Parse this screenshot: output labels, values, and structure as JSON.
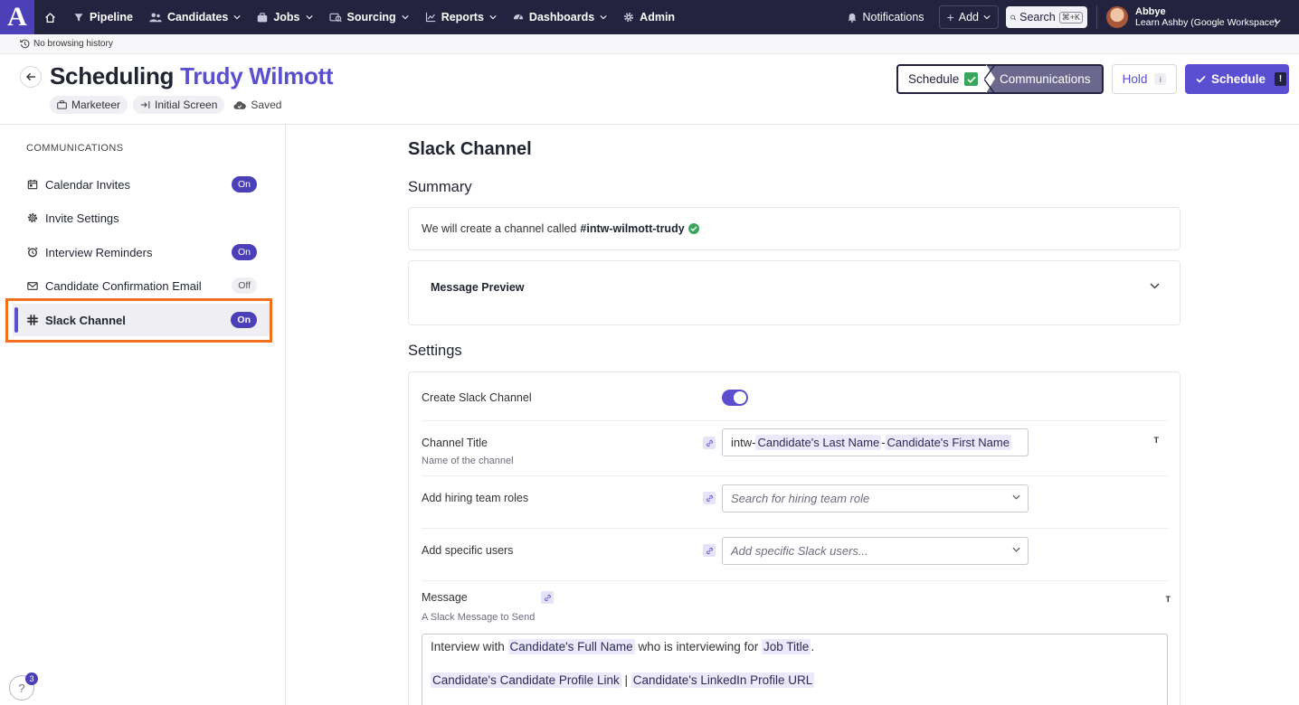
{
  "nav": {
    "logo": "A",
    "items": [
      {
        "label": "Pipeline",
        "icon": "filter-icon",
        "chevron": false
      },
      {
        "label": "Candidates",
        "icon": "people-icon",
        "chevron": true
      },
      {
        "label": "Jobs",
        "icon": "briefcase-icon",
        "chevron": true
      },
      {
        "label": "Sourcing",
        "icon": "sourcing-icon",
        "chevron": true
      },
      {
        "label": "Reports",
        "icon": "chart-icon",
        "chevron": true
      },
      {
        "label": "Dashboards",
        "icon": "dashboard-icon",
        "chevron": true
      },
      {
        "label": "Admin",
        "icon": "gear-icon",
        "chevron": false
      }
    ],
    "notifications": "Notifications",
    "add": "Add",
    "search": "Search",
    "search_shortcut": "⌘+K",
    "user_name": "Abbye",
    "user_org": "Learn Ashby (Google Workspace)"
  },
  "history": {
    "label": "No browsing history"
  },
  "header": {
    "title_prefix": "Scheduling",
    "candidate": "Trudy Wilmott",
    "tags": [
      "Marketeer",
      "Initial Screen"
    ],
    "saved": "Saved",
    "step1": "Schedule",
    "step2": "Communications",
    "hold": "Hold",
    "hold_badge": "i",
    "schedule": "Schedule",
    "schedule_badge": "!"
  },
  "sidebar": {
    "heading": "COMMUNICATIONS",
    "items": [
      {
        "label": "Calendar Invites",
        "status": "On",
        "icon": "calendar-icon"
      },
      {
        "label": "Invite Settings",
        "status": "",
        "icon": "gear-icon"
      },
      {
        "label": "Interview Reminders",
        "status": "On",
        "icon": "alarm-icon"
      },
      {
        "label": "Candidate Confirmation Email",
        "status": "Off",
        "icon": "mail-icon"
      },
      {
        "label": "Slack Channel",
        "status": "On",
        "icon": "slack-icon"
      }
    ],
    "help_count": "3",
    "help_glyph": "?"
  },
  "main": {
    "title": "Slack Channel",
    "summary_heading": "Summary",
    "summary_text": "We will create a channel called",
    "channel_name": "#intw-wilmott-trudy",
    "preview_title": "Message Preview",
    "settings_heading": "Settings",
    "create_label": "Create Slack Channel",
    "channel_title_label": "Channel Title",
    "channel_title_sub": "Name of the channel",
    "channel_title_prefix": "intw-",
    "channel_var1": "Candidate's Last Name",
    "channel_sep": "-",
    "channel_var2": "Candidate's First Name",
    "hiring_roles_label": "Add hiring team roles",
    "hiring_roles_placeholder": "Search for hiring team role",
    "users_label": "Add specific users",
    "users_placeholder": "Add specific Slack users...",
    "message_label": "Message",
    "message_sub": "A Slack Message to Send",
    "msg_prefix": "Interview with",
    "msg_var1": "Candidate's Full Name",
    "msg_mid": "who is interviewing for",
    "msg_var2": "Job Title",
    "msg_end": ".",
    "msg_var3": "Candidate's Candidate Profile Link",
    "msg_sep": "|",
    "msg_var4": "Candidate's LinkedIn Profile URL",
    "t_icon": "T"
  },
  "colors": {
    "accent": "#5a4fd0",
    "nav_bg": "#23223f",
    "highlight": "#f1701f",
    "success": "#3aa55c"
  }
}
